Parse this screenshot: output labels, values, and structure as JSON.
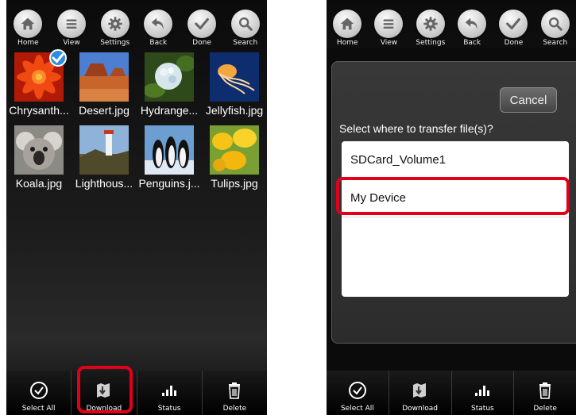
{
  "left_screen": {
    "toolbar": [
      {
        "label": "Home",
        "icon": "home-icon"
      },
      {
        "label": "View",
        "icon": "list-view-icon"
      },
      {
        "label": "Settings",
        "icon": "gear-icon"
      },
      {
        "label": "Back",
        "icon": "back-arrow-icon"
      },
      {
        "label": "Done",
        "icon": "checkmark-icon"
      },
      {
        "label": "Search",
        "icon": "search-icon"
      }
    ],
    "files": [
      {
        "name": "Chrysanth...",
        "selected": true
      },
      {
        "name": "Desert.jpg",
        "selected": false
      },
      {
        "name": "Hydrange...",
        "selected": false
      },
      {
        "name": "Jellyfish.jpg",
        "selected": false
      },
      {
        "name": "Koala.jpg",
        "selected": false
      },
      {
        "name": "Lighthous...",
        "selected": false
      },
      {
        "name": "Penguins.j...",
        "selected": false
      },
      {
        "name": "Tulips.jpg",
        "selected": false
      }
    ],
    "bottom_bar": [
      {
        "label": "Select All",
        "icon": "select-all-icon"
      },
      {
        "label": "Download",
        "icon": "download-icon"
      },
      {
        "label": "Status",
        "icon": "status-bars-icon"
      },
      {
        "label": "Delete",
        "icon": "trash-icon"
      }
    ]
  },
  "right_screen": {
    "toolbar": [
      {
        "label": "Home",
        "icon": "home-icon"
      },
      {
        "label": "View",
        "icon": "list-view-icon"
      },
      {
        "label": "Settings",
        "icon": "gear-icon"
      },
      {
        "label": "Back",
        "icon": "back-arrow-icon"
      },
      {
        "label": "Done",
        "icon": "checkmark-icon"
      },
      {
        "label": "Search",
        "icon": "search-icon"
      }
    ],
    "dialog": {
      "cancel_label": "Cancel",
      "prompt": "Select where to transfer file(s)?",
      "options": [
        "SDCard_Volume1",
        "My Device"
      ]
    },
    "bottom_bar": [
      {
        "label": "Select All",
        "icon": "select-all-icon"
      },
      {
        "label": "Download",
        "icon": "download-icon"
      },
      {
        "label": "Status",
        "icon": "status-bars-icon"
      },
      {
        "label": "Delete",
        "icon": "trash-icon"
      }
    ]
  },
  "colors": {
    "highlight": "#e0001a",
    "selection_badge": "#2c8ee0"
  }
}
